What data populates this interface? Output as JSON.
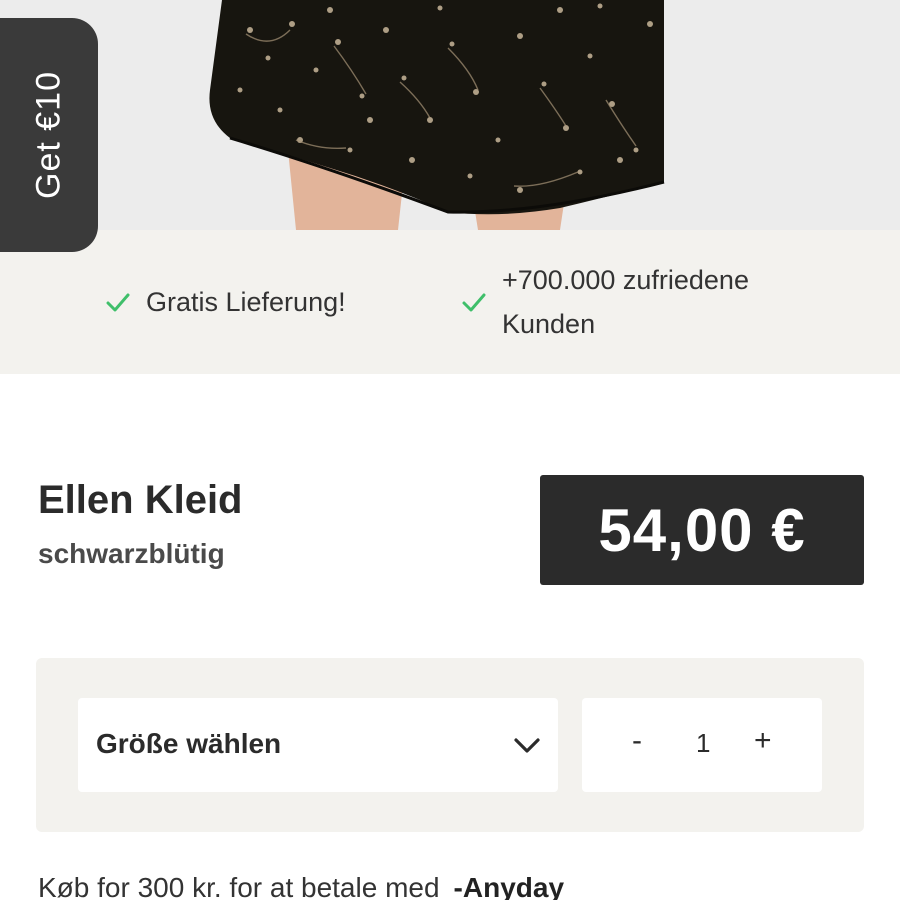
{
  "promo": {
    "label": "Get €10"
  },
  "usps": [
    {
      "icon": "check-icon",
      "text": "Gratis Lieferung!"
    },
    {
      "icon": "check-icon",
      "line1": "+700.000 zufriedene",
      "line2": "Kunden"
    }
  ],
  "product": {
    "name": "Ellen Kleid",
    "variant": "schwarzblütig",
    "price": "54,00 €"
  },
  "selector": {
    "size_label": "Größe wählen",
    "qty_minus": "-",
    "qty_value": "1",
    "qty_plus": "+"
  },
  "payment": {
    "text": "Køb for 300 kr. for at betale med",
    "brand": "-Anyday"
  },
  "colors": {
    "accent_check": "#3fbf6a",
    "dark": "#2b2b2b",
    "strip_bg": "#f3f2ee",
    "hero_bg": "#ececec"
  }
}
